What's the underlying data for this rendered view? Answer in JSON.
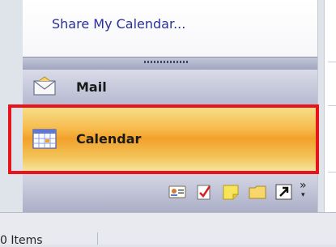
{
  "share_link": "Share My Calendar...",
  "nav": {
    "mail_label": "Mail",
    "calendar_label": "Calendar"
  },
  "toolbar": {
    "overflow_label": "»",
    "icons": [
      "contacts-icon",
      "tasks-icon",
      "notes-icon",
      "folder-list-icon",
      "shortcuts-icon",
      "configure-buttons-icon"
    ]
  },
  "status": {
    "items": "0 Items"
  },
  "colors": {
    "highlight": "#e8141c",
    "calendar_selected": "#f7bb4c",
    "link": "#2a2f9a"
  }
}
